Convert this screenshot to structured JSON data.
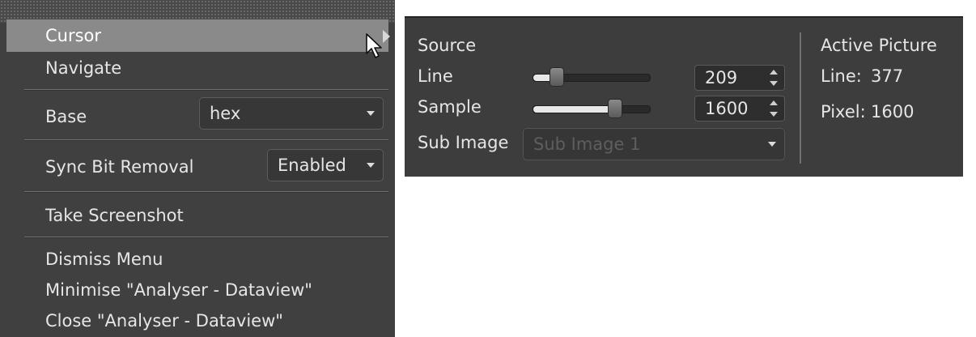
{
  "menu": {
    "items": {
      "cursor": "Cursor",
      "navigate": "Navigate",
      "base_label": "Base",
      "base_value": "hex",
      "sync_label": "Sync Bit Removal",
      "sync_value": "Enabled",
      "screenshot": "Take Screenshot",
      "dismiss": "Dismiss Menu",
      "minimise": "Minimise \"Analyser - Dataview\"",
      "close": "Close \"Analyser - Dataview\""
    }
  },
  "panel": {
    "source_title": "Source",
    "line_label": "Line",
    "line_value": "209",
    "line_slider_fraction": 0.2,
    "sample_label": "Sample",
    "sample_value": "1600",
    "sample_slider_fraction": 0.7,
    "sub_image_label": "Sub Image",
    "sub_image_value": "Sub Image 1",
    "active_title": "Active Picture",
    "active_line_label": "Line:",
    "active_line_value": "377",
    "active_pixel_label": "Pixel:",
    "active_pixel_value": "1600"
  },
  "icons": {
    "submenu": "chevron-right-icon",
    "pointer": "mouse-pointer-icon",
    "dropdown": "chevron-down-icon",
    "spin": "spin-arrows-icon"
  },
  "colors": {
    "menu_bg": "#404040",
    "menu_highlight": "#8a8a8a",
    "panel_bg": "#3d3d3d"
  }
}
